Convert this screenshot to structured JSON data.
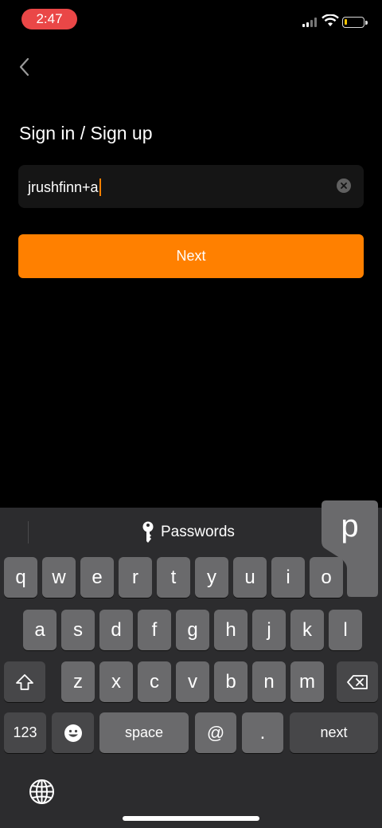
{
  "status_bar": {
    "time": "2:47"
  },
  "page": {
    "title": "Sign in / Sign up"
  },
  "email_field": {
    "value": "jrushfinn+a"
  },
  "next_button": {
    "label": "Next"
  },
  "keyboard": {
    "suggestion": "Passwords",
    "popup_key": "p",
    "row1": [
      "q",
      "w",
      "e",
      "r",
      "t",
      "y",
      "u",
      "i",
      "o"
    ],
    "row2": [
      "a",
      "s",
      "d",
      "f",
      "g",
      "h",
      "j",
      "k",
      "l"
    ],
    "row3": [
      "z",
      "x",
      "c",
      "v",
      "b",
      "n",
      "m"
    ],
    "numbers_key": "123",
    "space_key": "space",
    "at_key": "@",
    "period_key": ".",
    "return_key": "next"
  },
  "colors": {
    "accent": "#ff8000",
    "time_pill": "#ea4747",
    "keyboard_bg": "#2c2c2e",
    "key": "#6a6a6c"
  }
}
